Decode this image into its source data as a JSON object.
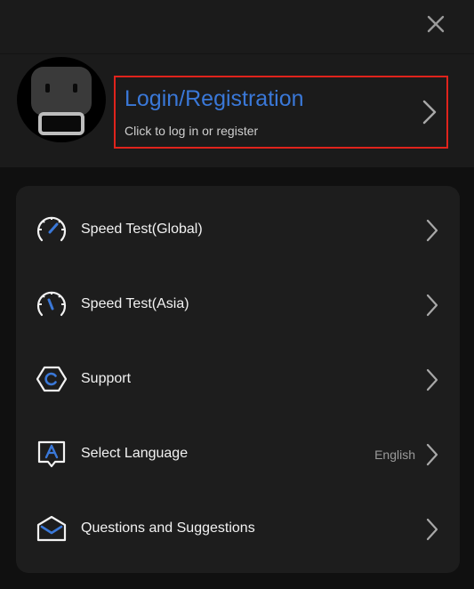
{
  "header": {
    "close_icon": "close-icon"
  },
  "profile": {
    "avatar_icon": "robot-avatar-icon",
    "login_title": "Login/Registration",
    "login_subtitle": "Click to log in or register"
  },
  "menu": {
    "items": [
      {
        "label": "Speed Test(Global)",
        "icon": "speedometer-icon",
        "value": ""
      },
      {
        "label": "Speed Test(Asia)",
        "icon": "speedometer-icon",
        "value": ""
      },
      {
        "label": "Support",
        "icon": "support-hexagon-icon",
        "value": ""
      },
      {
        "label": "Select Language",
        "icon": "language-icon",
        "value": "English"
      },
      {
        "label": "Questions and Suggestions",
        "icon": "envelope-icon",
        "value": ""
      }
    ]
  },
  "colors": {
    "accent": "#3a78d8",
    "highlight_border": "#e0231c",
    "panel_bg": "#1d1d1d",
    "header_bg": "#1b1b1b",
    "page_bg": "#101010"
  }
}
